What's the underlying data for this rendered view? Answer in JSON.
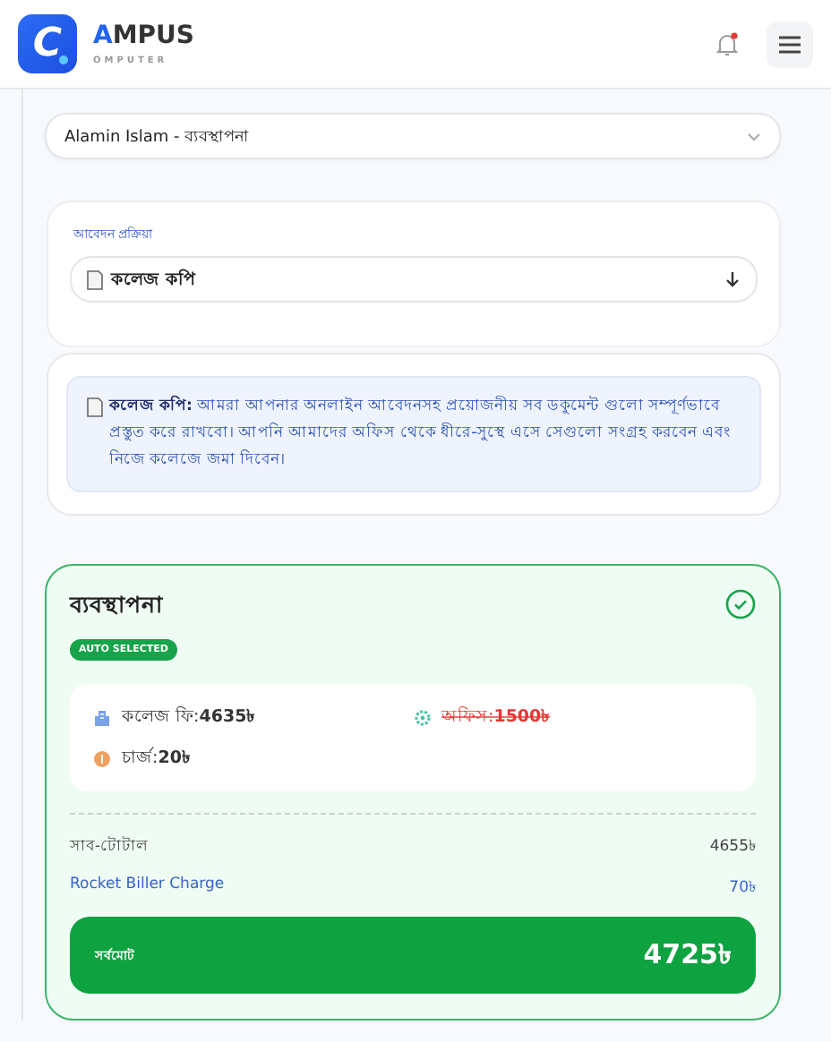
{
  "header": {
    "logo_letter": "C",
    "brand": "AMPUS",
    "tagline": "OMPUTER",
    "has_unread": true
  },
  "student_select": {
    "value": "Alamin Islam - ব্যবস্থাপনা"
  },
  "process": {
    "label": "আবেদন প্রক্রিয়া",
    "value": "কলেজ কপি"
  },
  "info": {
    "text": "**কলেজ কপি:** আমরা আপনার অনলাইন আবেদনসহ প্রয়োজনীয় সব ডকুমেন্ট গুলো সম্পূর্ণভাবে প্রস্তুত করে রাখবো। আপনি আমাদের অফিস থেকে ধীরে-সুস্থে এসে সেগুলো সংগ্রহ করবেন এবং নিজে কলেজে জমা দিবেন।"
  },
  "plan": {
    "title": "ব্যবস্থাপনা",
    "selected": true,
    "badge": "AUTO SELECTED",
    "fees": [
      {
        "kind": "college",
        "text": "কলেজ ফি:**4635৳**",
        "struck": false
      },
      {
        "kind": "office",
        "text": "অফিস:**1500৳**",
        "struck": true
      },
      {
        "kind": "charge",
        "text": "চার্জ:**20৳**",
        "struck": false
      }
    ],
    "subtotal": {
      "label": "সাব-টোটাল",
      "value": "4655৳"
    },
    "biller": {
      "label": "Rocket Biller Charge",
      "value": "70৳"
    },
    "total": {
      "label": "সর্বমোট",
      "value": "4725৳"
    }
  }
}
